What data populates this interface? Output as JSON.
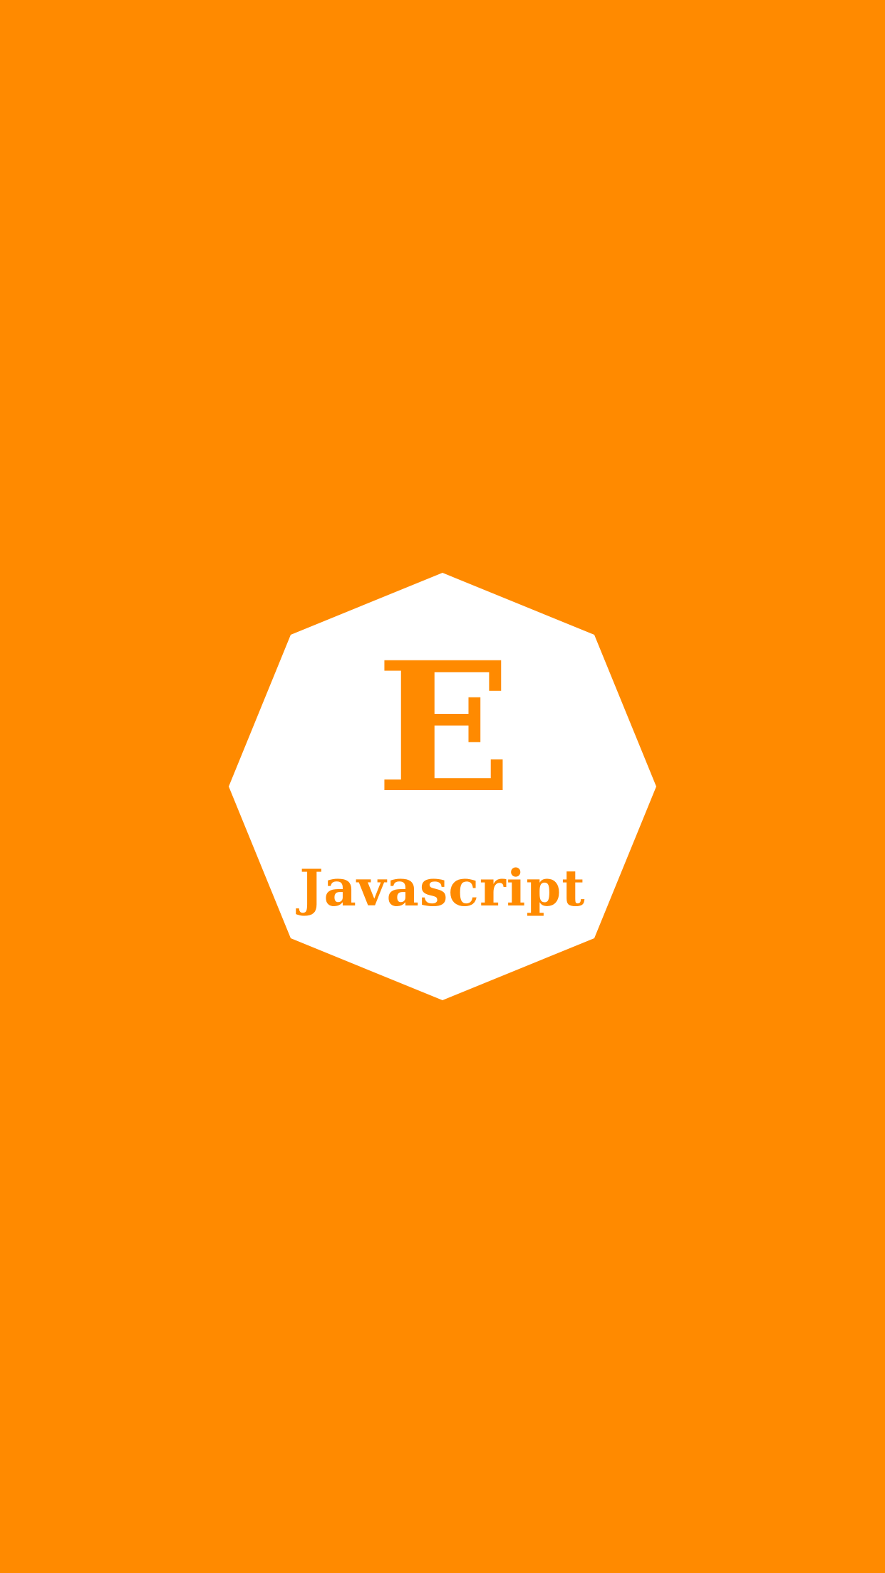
{
  "colors": {
    "background": "#ff8a00",
    "badge": "#ffffff",
    "text": "#ff8a00"
  },
  "splash": {
    "logo_mark": "E",
    "app_name": "Javascript"
  }
}
